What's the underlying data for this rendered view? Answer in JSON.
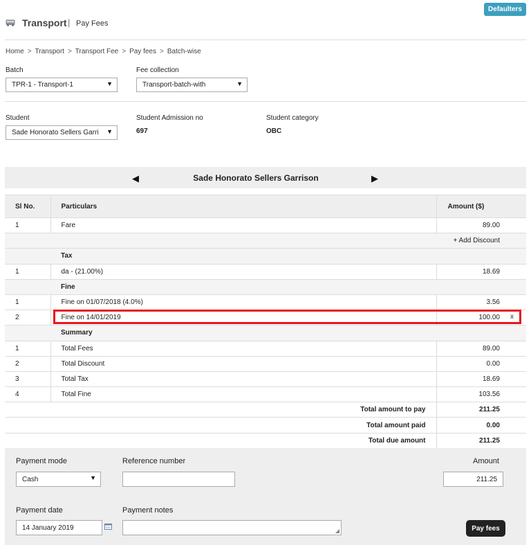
{
  "header": {
    "title": "Transport",
    "separator": "|",
    "subtitle": "Pay Fees",
    "defaulters_label": "Defaulters"
  },
  "breadcrumb": [
    "Home",
    "Transport",
    "Transport Fee",
    "Pay fees",
    "Batch-wise"
  ],
  "breadcrumb_sep": ">",
  "filters": {
    "batch_label": "Batch",
    "batch_value": "TPR-1 - Transport-1",
    "fee_collection_label": "Fee collection",
    "fee_collection_value": "Transport-batch-with",
    "student_label": "Student",
    "student_value": "Sade Honorato Sellers Garri",
    "admission_label": "Student Admission no",
    "admission_value": "697",
    "category_label": "Student category",
    "category_value": "OBC"
  },
  "student_nav": {
    "name": "Sade Honorato Sellers Garrison",
    "prev": "◀",
    "next": "▶"
  },
  "table": {
    "headers": [
      "Sl No.",
      "Particulars",
      "Amount ($)"
    ],
    "fare": {
      "no": "1",
      "name": "Fare",
      "amount": "89.00"
    },
    "add_discount": "+ Add Discount",
    "tax_section": "Tax",
    "tax": {
      "no": "1",
      "name": "da - (21.00%)",
      "amount": "18.69"
    },
    "fine_section": "Fine",
    "fines": [
      {
        "no": "1",
        "name": "Fine on 01/07/2018 (4.0%)",
        "amount": "3.56"
      },
      {
        "no": "2",
        "name": "Fine on 14/01/2019",
        "amount": "100.00"
      }
    ],
    "remove_label": "x",
    "summary_section": "Summary",
    "summary": [
      {
        "no": "1",
        "name": "Total Fees",
        "amount": "89.00"
      },
      {
        "no": "2",
        "name": "Total Discount",
        "amount": "0.00"
      },
      {
        "no": "3",
        "name": "Total Tax",
        "amount": "18.69"
      },
      {
        "no": "4",
        "name": "Total Fine",
        "amount": "103.56"
      }
    ],
    "totals": [
      {
        "name": "Total amount to pay",
        "amount": "211.25"
      },
      {
        "name": "Total amount paid",
        "amount": "0.00"
      },
      {
        "name": "Total due amount",
        "amount": "211.25"
      }
    ]
  },
  "payment": {
    "mode_label": "Payment mode",
    "mode_value": "Cash",
    "reference_label": "Reference number",
    "reference_value": "",
    "amount_label": "Amount",
    "amount_value": "211.25",
    "date_label": "Payment date",
    "date_value": "14 January 2019",
    "notes_label": "Payment notes",
    "notes_value": "",
    "pay_button": "Pay fees"
  },
  "colors": {
    "accent": "#3d9fbf",
    "highlight": "#e8151b",
    "panel": "#eeeeee",
    "pay_button": "#222222"
  },
  "icons": [
    "bus-icon",
    "dropdown-arrow-icon",
    "prev-arrow-icon",
    "next-arrow-icon",
    "calendar-icon"
  ]
}
